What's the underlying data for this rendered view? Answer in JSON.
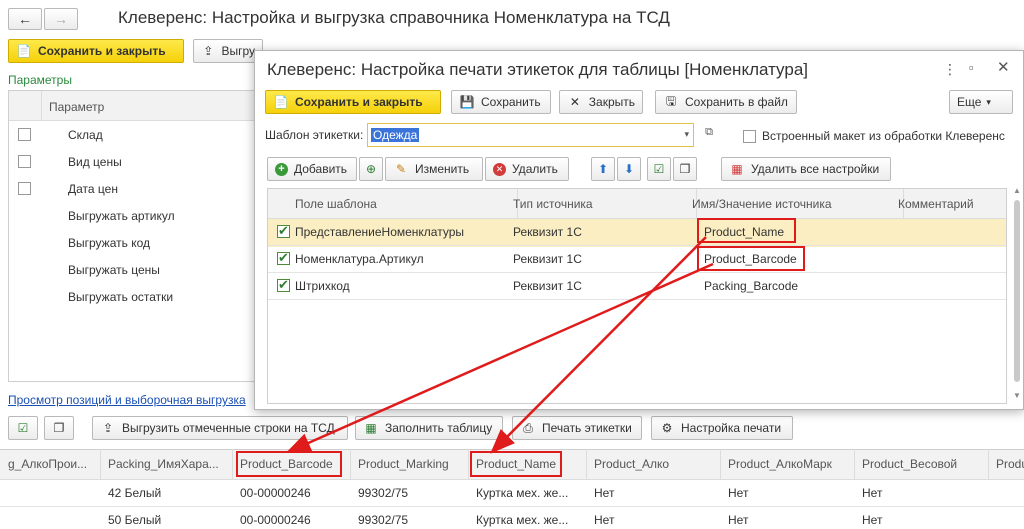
{
  "main_window": {
    "title": "Клеверенс: Настройка и выгрузка справочника Номенклатура на ТСД",
    "nav_back_icon": "arrow-left-icon",
    "nav_forward_icon": "arrow-right-icon",
    "save_close_label": "Сохранить и закрыть",
    "upload_label": "Выгру",
    "params_link": "Параметры",
    "params_header": "Параметр",
    "params": [
      {
        "label": "Склад",
        "checkbox": true
      },
      {
        "label": "Вид цены",
        "checkbox": true
      },
      {
        "label": "Дата цен",
        "checkbox": true
      },
      {
        "label": "Выгружать артикул",
        "checkbox": false
      },
      {
        "label": "Выгружать код",
        "checkbox": false
      },
      {
        "label": "Выгружать цены",
        "checkbox": false
      },
      {
        "label": "Выгружать остатки",
        "checkbox": false
      }
    ],
    "view_link": "Просмотр позиций и выборочная выгрузка",
    "toolbar": {
      "upload_marked": "Выгрузить отмеченные строки на ТСД",
      "fill_table": "Заполнить таблицу",
      "print_labels": "Печать этикетки",
      "print_settings": "Настройка печати"
    },
    "grid_columns": [
      "g_АлкоПрои...",
      "Packing_ИмяХара...",
      "Product_Barcode",
      "Product_Marking",
      "Product_Name",
      "Product_Алко",
      "Product_АлкоМарк",
      "Product_Весовой",
      "Produ"
    ],
    "grid_rows": [
      [
        "",
        "42 Белый",
        "00-00000246",
        "99302/75",
        "Куртка мех. же...",
        "Нет",
        "Нет",
        "Нет",
        ""
      ],
      [
        "",
        "50 Белый",
        "00-00000246",
        "99302/75",
        "Куртка мех. же...",
        "Нет",
        "Нет",
        "Нет",
        ""
      ]
    ]
  },
  "dialog": {
    "title": "Клеверенс: Настройка печати этикеток для таблицы [Номенклатура]",
    "save_close_label": "Сохранить и закрыть",
    "save_label": "Сохранить",
    "close_label": "Закрыть",
    "save_file_label": "Сохранить в файл",
    "more_label": "Еще",
    "template_label": "Шаблон этикетки:",
    "template_value": "Одежда",
    "builtin_label": "Встроенный макет из обработки Клеверенс",
    "add_label": "Добавить",
    "edit_label": "Изменить",
    "delete_label": "Удалить",
    "delete_all_label": "Удалить все настройки",
    "columns": [
      "Поле шаблона",
      "Тип источника",
      "Имя/Значение источника",
      "Комментарий"
    ],
    "rows": [
      {
        "checked": true,
        "field": "ПредставлениеНоменклатуры",
        "type": "Реквизит 1С",
        "source": "Product_Name",
        "comment": ""
      },
      {
        "checked": true,
        "field": "Номенклатура.Артикул",
        "type": "Реквизит 1С",
        "source": "Product_Barcode",
        "comment": ""
      },
      {
        "checked": true,
        "field": "Штрихкод",
        "type": "Реквизит 1С",
        "source": "Packing_Barcode",
        "comment": ""
      }
    ]
  },
  "colors": {
    "accent_yellow": "#f5d10a",
    "selected_row": "#fbeec2",
    "annotation_red": "#e01b1b",
    "link_green": "#2b8a3e",
    "link_blue": "#1a4fb4"
  }
}
